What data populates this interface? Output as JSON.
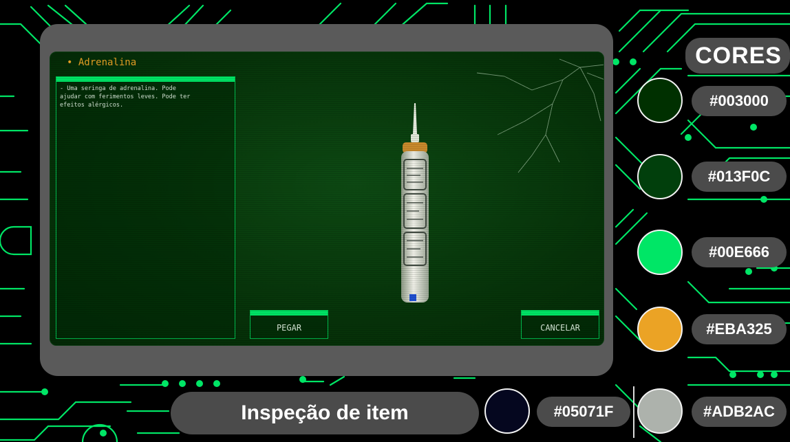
{
  "item": {
    "title": "• Adrenalina",
    "description": "- Uma seringa de adrenalina. Pode\najudar com ferimentos leves. Pode ter\nefeitos alérgicos."
  },
  "buttons": {
    "take_label": "PEGAR",
    "cancel_label": "CANCELAR"
  },
  "palette": {
    "title": "CORES",
    "colors": [
      {
        "hex": "#003000",
        "label": "#003000"
      },
      {
        "hex": "#013F0C",
        "label": "#013F0C"
      },
      {
        "hex": "#00E666",
        "label": "#00E666"
      },
      {
        "hex": "#EBA325",
        "label": "#EBA325"
      },
      {
        "hex": "#05071F",
        "label": "#05071F"
      },
      {
        "hex": "#ADB2AC",
        "label": "#ADB2AC"
      }
    ]
  },
  "caption": "Inspeção de item",
  "accent_colors": {
    "circuit": "#00E666",
    "frame": "#5a5a5a",
    "pill": "#4b4b4b"
  }
}
